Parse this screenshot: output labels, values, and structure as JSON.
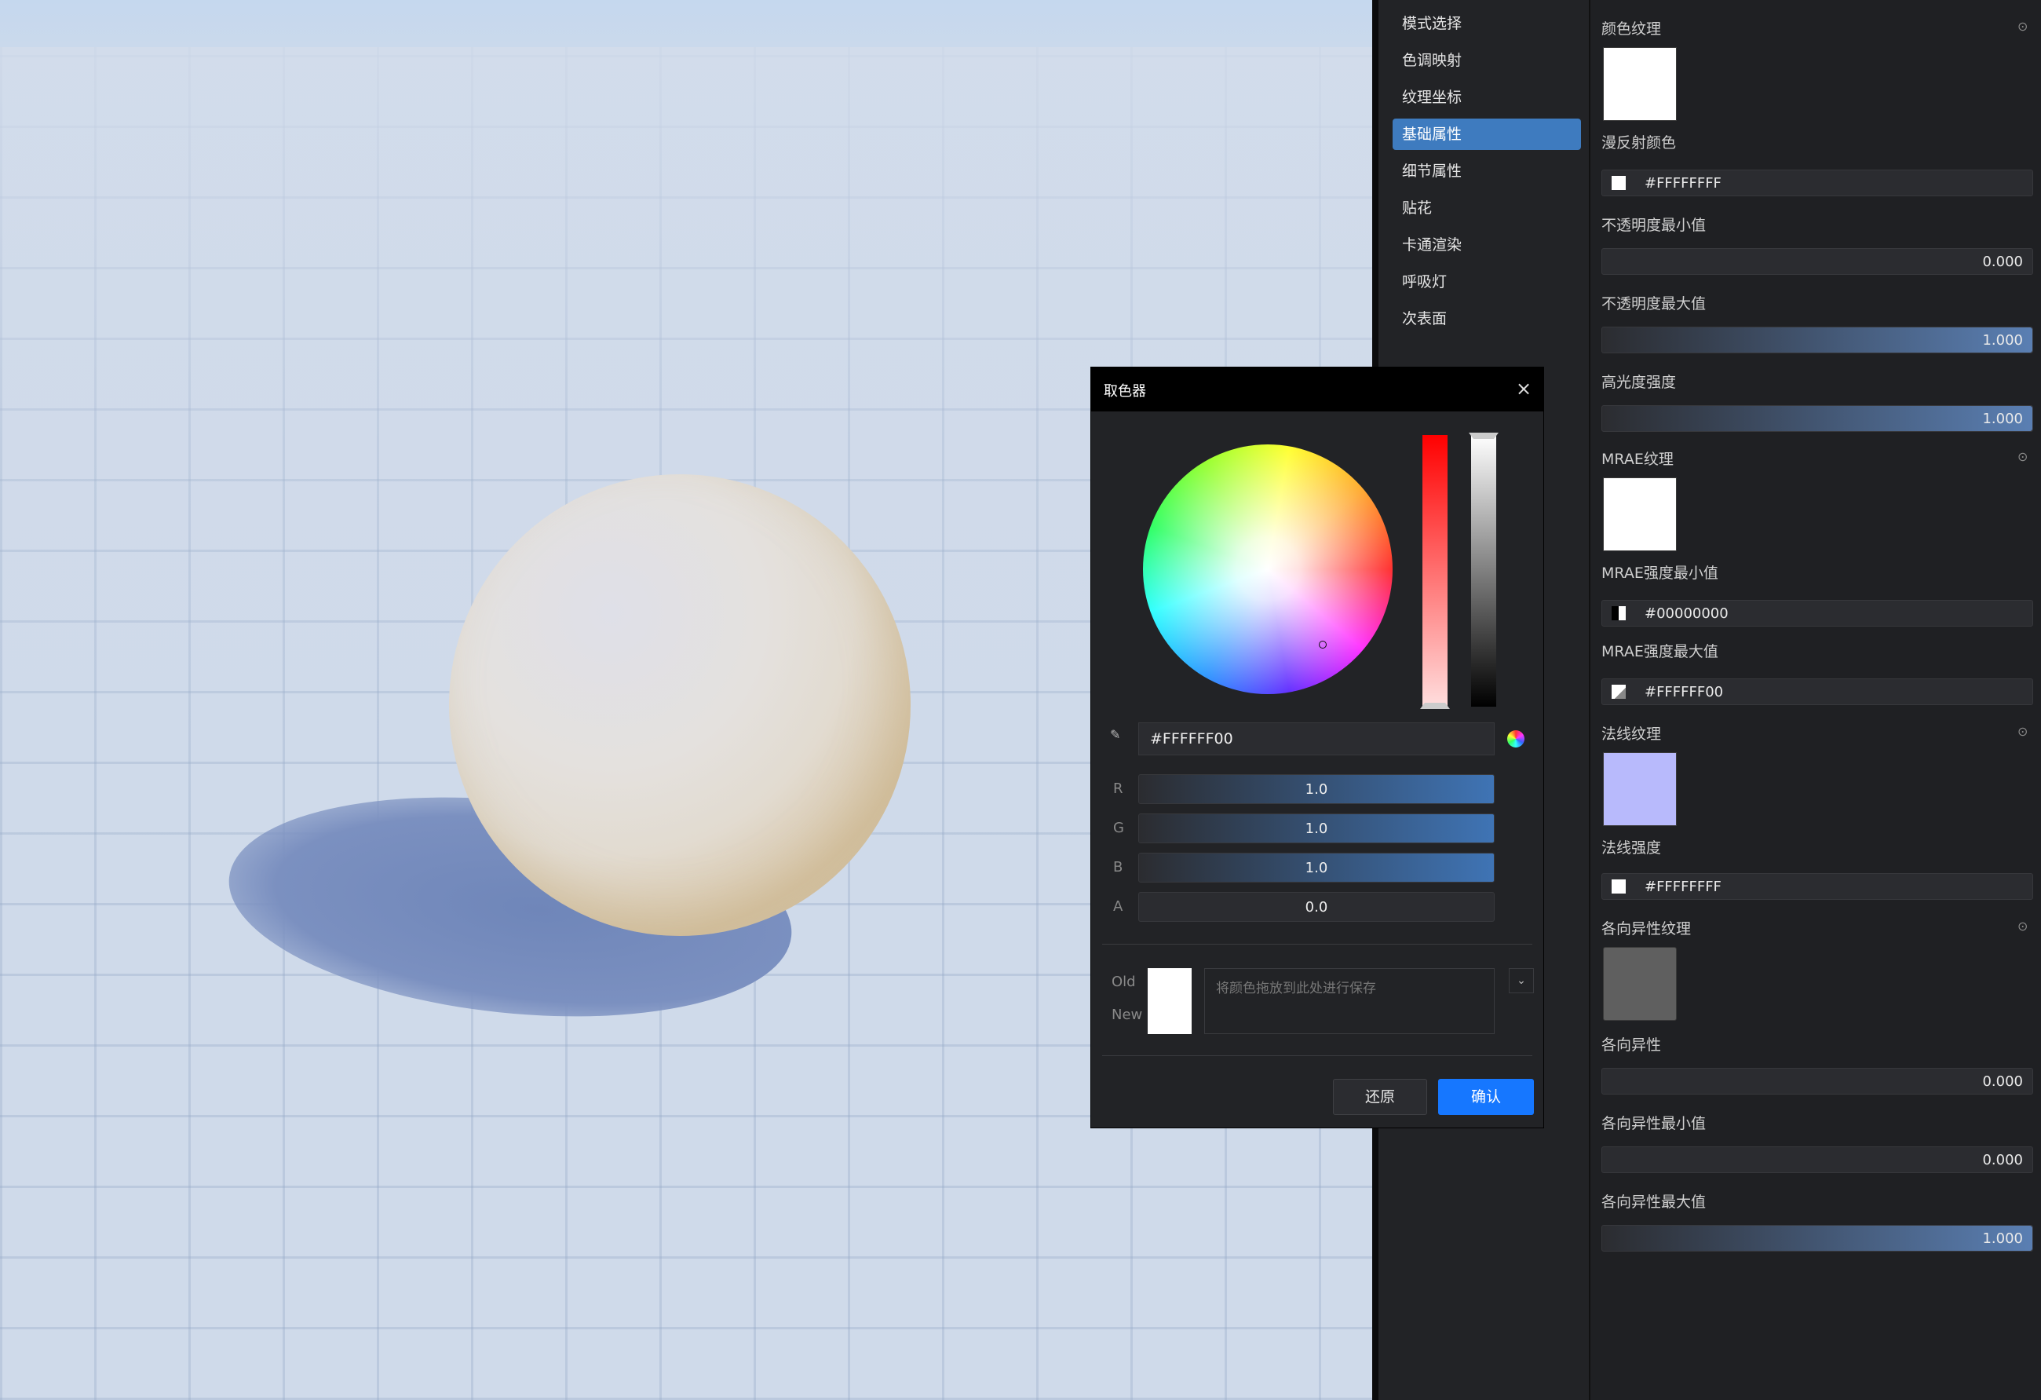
{
  "nav": {
    "items": [
      {
        "label": "模式选择",
        "active": false
      },
      {
        "label": "色调映射",
        "active": false
      },
      {
        "label": "纹理坐标",
        "active": false
      },
      {
        "label": "基础属性",
        "active": true
      },
      {
        "label": "细节属性",
        "active": false
      },
      {
        "label": "贴花",
        "active": false
      },
      {
        "label": "卡通渲染",
        "active": false
      },
      {
        "label": "呼吸灯",
        "active": false
      },
      {
        "label": "次表面",
        "active": false
      }
    ]
  },
  "props": {
    "color_texture": "颜色纹理",
    "diffuse_color": "漫反射颜色",
    "diffuse_hex": "#FFFFFFFF",
    "opacity_min": "不透明度最小值",
    "opacity_min_val": "0.000",
    "opacity_max": "不透明度最大值",
    "opacity_max_val": "1.000",
    "specular": "高光度强度",
    "specular_val": "1.000",
    "mrae_texture": "MRAE纹理",
    "mrae_min": "MRAE强度最小值",
    "mrae_min_hex": "#00000000",
    "mrae_max": "MRAE强度最大值",
    "mrae_max_hex": "#FFFFFF00",
    "normal_texture": "法线纹理",
    "normal_strength": "法线强度",
    "normal_hex": "#FFFFFFFF",
    "aniso_texture": "各向异性纹理",
    "aniso": "各向异性",
    "aniso_val": "0.000",
    "aniso_min": "各向异性最小值",
    "aniso_min_val": "0.000",
    "aniso_max": "各向异性最大值",
    "aniso_max_val": "1.000"
  },
  "picker": {
    "title": "取色器",
    "close": "×",
    "hex": "#FFFFFF00",
    "channels": [
      {
        "label": "R",
        "value": "1.0",
        "level": 1.0
      },
      {
        "label": "G",
        "value": "1.0",
        "level": 1.0
      },
      {
        "label": "B",
        "value": "1.0",
        "level": 1.0
      },
      {
        "label": "A",
        "value": "0.0",
        "level": 0.0
      }
    ],
    "old_label": "Old",
    "new_label": "New",
    "save_placeholder": "将颜色拖放到此处进行保存",
    "reset_label": "还原",
    "confirm_label": "确认"
  },
  "colors": {
    "accent": "#1677ff",
    "nav_active": "#3e7bbf",
    "normal_swatch": "#b8bafc",
    "aniso_swatch": "#5f5f5f"
  }
}
